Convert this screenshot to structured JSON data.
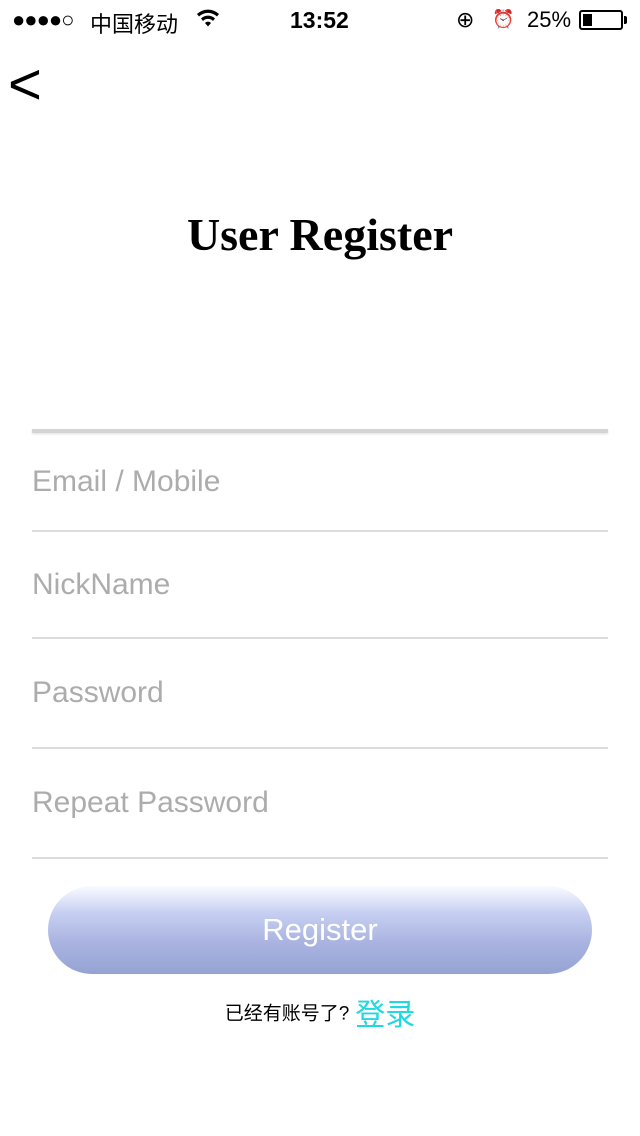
{
  "status_bar": {
    "signal": "●●●●○",
    "carrier": "中国移动",
    "wifi_icon": "wifi-icon",
    "time": "13:52",
    "lock_icon": "⊕",
    "alarm_icon": "⏰",
    "battery": "25%",
    "battery_level": 0.25
  },
  "nav": {
    "back_label": "<"
  },
  "title": "User Register",
  "fields": [
    {
      "placeholder": "Email / Mobile",
      "value": ""
    },
    {
      "placeholder": "NickName",
      "value": ""
    },
    {
      "placeholder": "Password",
      "value": ""
    },
    {
      "placeholder": "Repeat Password",
      "value": ""
    }
  ],
  "register_label": "Register",
  "footer": {
    "question": "已经有账号了?",
    "login_link": "登录"
  },
  "colors": {
    "link": "#20d8e0",
    "button": "#a9b3e0"
  }
}
